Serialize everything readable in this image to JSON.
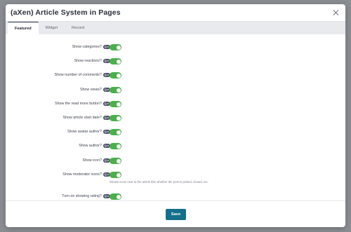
{
  "modal": {
    "title": "(aXen) Article System in Pages",
    "close_icon": "close-icon",
    "save_label": "Save"
  },
  "tabs": [
    {
      "label": "Featured",
      "active": true
    },
    {
      "label": "Widget",
      "active": false
    },
    {
      "label": "Record",
      "active": false
    }
  ],
  "help_badge_text": "Q e",
  "settings": [
    {
      "label": "Show categories?",
      "enabled": true
    },
    {
      "label": "Show reactions?",
      "enabled": true
    },
    {
      "label": "Show number of comments?",
      "enabled": true
    },
    {
      "label": "Show views?",
      "enabled": true
    },
    {
      "label": "Show the read more button?",
      "enabled": true
    },
    {
      "label": "Show article start date?",
      "enabled": true
    },
    {
      "label": "Show avatar author?",
      "enabled": true
    },
    {
      "label": "Show author?",
      "enabled": true
    },
    {
      "label": "Show icon?",
      "enabled": true
    },
    {
      "label": "Show moderator icons?",
      "enabled": true,
      "hint": "Shows icons next to the article title whether the post is picked, closed, etc."
    },
    {
      "label": "Turn on showing rating?",
      "enabled": true
    }
  ],
  "colors": {
    "toggle_on": "#4cae4c",
    "save_button": "#14708a"
  }
}
